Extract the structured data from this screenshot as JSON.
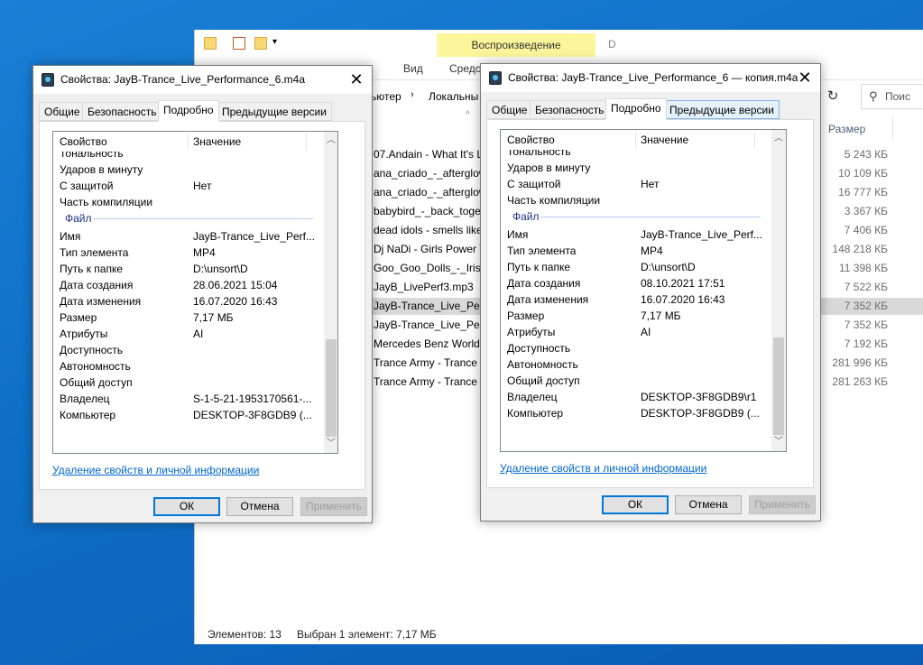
{
  "explorer": {
    "contextual_tab": "Воспроизведение",
    "contextual_tab_extra": "D",
    "ribbon_tabs": [
      "Вид",
      "Средст"
    ],
    "address_parts": [
      "ьютер",
      "Локальны"
    ],
    "search_placeholder": "Поис",
    "size_header": "Размер",
    "files": [
      {
        "name": "07.Andain - What It's L",
        "size": "5 243 КБ"
      },
      {
        "name": "ana_criado_-_afterglow",
        "size": "10 109 КБ"
      },
      {
        "name": "ana_criado_-_afterglow",
        "size": "16 777 КБ"
      },
      {
        "name": "babybird_-_back_toget",
        "size": "3 367 КБ"
      },
      {
        "name": "dead idols - smells like",
        "size": "7 406 КБ"
      },
      {
        "name": "Dj NaDi - Girls Power V",
        "size": "148 218 КБ"
      },
      {
        "name": "Goo_Goo_Dolls_-_Iris_4",
        "size": "11 398 КБ"
      },
      {
        "name": "JayB_LivePerf3.mp3",
        "size": "7 522 КБ"
      },
      {
        "name": "JayB-Trance_Live_Perfo",
        "size": "7 352 КБ"
      },
      {
        "name": "JayB-Trance_Live_Perfo",
        "size": "7 352 КБ"
      },
      {
        "name": "Mercedes Benz World R",
        "size": "7 192 КБ"
      },
      {
        "name": "Trance Army - Trance E",
        "size": "281 996 КБ"
      },
      {
        "name": "Trance Army - Trance E",
        "size": "281 263 КБ"
      }
    ],
    "status_count": "Элементов: 13",
    "status_selected": "Выбран 1 элемент: 7,17 МБ"
  },
  "dialogs": [
    {
      "title": "Свойства: JayB-Trance_Live_Performance_6.m4a",
      "tabs": [
        "Общие",
        "Безопасность",
        "Подробно",
        "Предыдущие версии"
      ],
      "col_property": "Свойство",
      "col_value": "Значение",
      "cut_row": "Тональность",
      "rows_top": [
        {
          "prop": "Ударов в минуту",
          "val": ""
        },
        {
          "prop": "С защитой",
          "val": "Нет"
        },
        {
          "prop": "Часть компиляции",
          "val": ""
        }
      ],
      "group": "Файл",
      "rows_file": [
        {
          "prop": "Имя",
          "val": "JayB-Trance_Live_Perf..."
        },
        {
          "prop": "Тип элемента",
          "val": "MP4"
        },
        {
          "prop": "Путь к папке",
          "val": "D:\\unsort\\D"
        },
        {
          "prop": "Дата создания",
          "val": "28.06.2021 15:04"
        },
        {
          "prop": "Дата изменения",
          "val": "16.07.2020 16:43"
        },
        {
          "prop": "Размер",
          "val": "7,17 МБ"
        },
        {
          "prop": "Атрибуты",
          "val": "AI"
        },
        {
          "prop": "Доступность",
          "val": ""
        },
        {
          "prop": "Автономность",
          "val": ""
        },
        {
          "prop": "Общий доступ",
          "val": ""
        },
        {
          "prop": "Владелец",
          "val": "S-1-5-21-1953170561-..."
        },
        {
          "prop": "Компьютер",
          "val": "DESKTOP-3F8GDB9 (..."
        }
      ],
      "remove_link": "Удаление свойств и личной информации",
      "ok": "ОК",
      "cancel": "Отмена",
      "apply": "Применить"
    },
    {
      "title": "Свойства: JayB-Trance_Live_Performance_6 — копия.m4a",
      "tabs": [
        "Общие",
        "Безопасность",
        "Подробно",
        "Предыдущие версии"
      ],
      "col_property": "Свойство",
      "col_value": "Значение",
      "cut_row": "Тональность",
      "rows_top": [
        {
          "prop": "Ударов в минуту",
          "val": ""
        },
        {
          "prop": "С защитой",
          "val": "Нет"
        },
        {
          "prop": "Часть компиляции",
          "val": ""
        }
      ],
      "group": "Файл",
      "rows_file": [
        {
          "prop": "Имя",
          "val": "JayB-Trance_Live_Perf..."
        },
        {
          "prop": "Тип элемента",
          "val": "MP4"
        },
        {
          "prop": "Путь к папке",
          "val": "D:\\unsort\\D"
        },
        {
          "prop": "Дата создания",
          "val": "08.10.2021 17:51"
        },
        {
          "prop": "Дата изменения",
          "val": "16.07.2020 16:43"
        },
        {
          "prop": "Размер",
          "val": "7,17 МБ"
        },
        {
          "prop": "Атрибуты",
          "val": "AI"
        },
        {
          "prop": "Доступность",
          "val": ""
        },
        {
          "prop": "Автономность",
          "val": ""
        },
        {
          "prop": "Общий доступ",
          "val": ""
        },
        {
          "prop": "Владелец",
          "val": "DESKTOP-3F8GDB9\\r1"
        },
        {
          "prop": "Компьютер",
          "val": "DESKTOP-3F8GDB9 (..."
        }
      ],
      "remove_link": "Удаление свойств и личной информации",
      "ok": "ОК",
      "cancel": "Отмена",
      "apply": "Применить"
    }
  ]
}
